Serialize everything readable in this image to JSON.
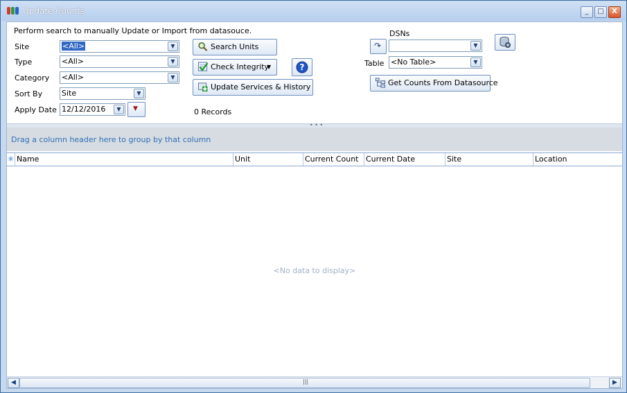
{
  "window": {
    "title": "Update Counts",
    "minimize": "_",
    "maximize": "□",
    "close": "X"
  },
  "search": {
    "instruction": "Perform search to manually Update or Import from datasouce.",
    "site": {
      "label": "Site",
      "value": "<All>"
    },
    "type": {
      "label": "Type",
      "value": "<All>"
    },
    "category": {
      "label": "Category",
      "value": "<All>"
    },
    "sort_by": {
      "label": "Sort By",
      "value": "Site"
    },
    "apply_date": {
      "label": "Apply Date",
      "value": "12/12/2016"
    },
    "buttons": {
      "search_units": "Search Units",
      "check_integrity": "Check Integrity",
      "update_services": "Update Services & History"
    },
    "records": "0 Records"
  },
  "datasource": {
    "dsns_label": "DSNs",
    "dsns_value": "",
    "table_label": "Table",
    "table_value": "<No Table>",
    "get_counts": "Get Counts From Datasource"
  },
  "grid": {
    "group_hint": "Drag a column header here to group by that column",
    "columns": [
      "Name",
      "Unit",
      "Current Count",
      "Current Date",
      "Site",
      "Location"
    ],
    "empty_text": "<No data to display>"
  },
  "colors": {
    "accent": "#3168c4",
    "hint_text": "#2e6fb7",
    "empty_text": "#a0b0c8"
  }
}
